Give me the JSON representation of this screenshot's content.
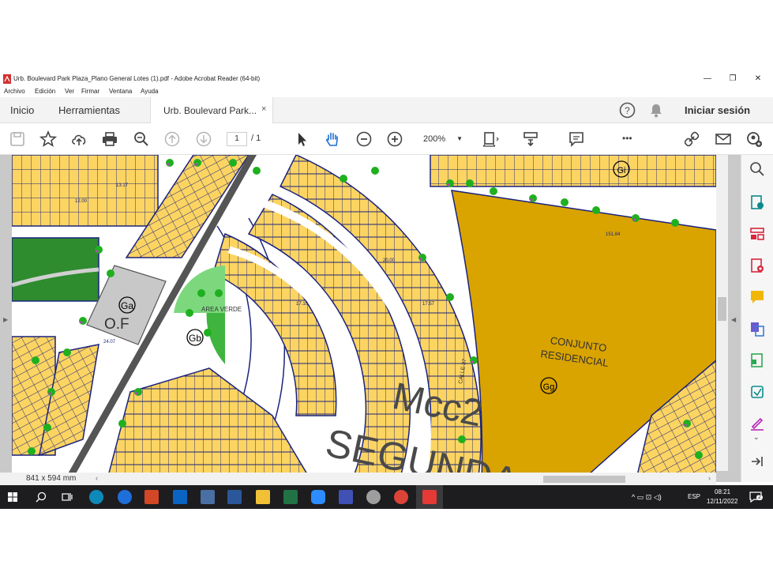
{
  "window": {
    "title": "Urb. Boulevard Park Plaza_Plano General Lotes (1).pdf - Adobe Acrobat Reader (64-bit)",
    "minimize_label": "—",
    "restore_label": "❐",
    "close_label": "✕"
  },
  "menu": [
    "Archivo",
    "Edición",
    "Ver",
    "Firmar",
    "Ventana",
    "Ayuda"
  ],
  "tabs": {
    "home": "Inicio",
    "tools": "Herramientas",
    "document": "Urb. Boulevard Park...",
    "close": "×",
    "help": "?",
    "signin": "Iniciar sesión"
  },
  "toolbar": {
    "page_current": "1",
    "page_total": "/ 1",
    "zoom": "200%",
    "more": "•••"
  },
  "map_labels": {
    "ga": "Ga",
    "gb": "Gb",
    "gi": "Gi",
    "gg": "Gg",
    "of": "O.F",
    "area_verde": "AREA VERDE",
    "conjunto": "CONJUNTO",
    "residencial": "RESIDENCIAL",
    "mcc2": "Mcc2",
    "segunda": "SEGUNDA",
    "calle_main": "CALLE 37",
    "dim_top": "151.84",
    "lot_values": [
      "20.00",
      "17.10",
      "12.00",
      "17.57",
      "13.17",
      "24.07"
    ]
  },
  "status": {
    "page_size": "841 x 594 mm"
  },
  "taskbar": {
    "lang": "ESP",
    "time": "08:21",
    "date": "12/11/2022",
    "notifications": "2"
  },
  "colors": {
    "lot_fill": "#fcd462",
    "lot_outline": "#1a237e",
    "residential": "#d9a300",
    "green_area": "#2e8b2e",
    "road": "#ffffff",
    "median": "#555555",
    "of_block": "#c8c8c8"
  }
}
